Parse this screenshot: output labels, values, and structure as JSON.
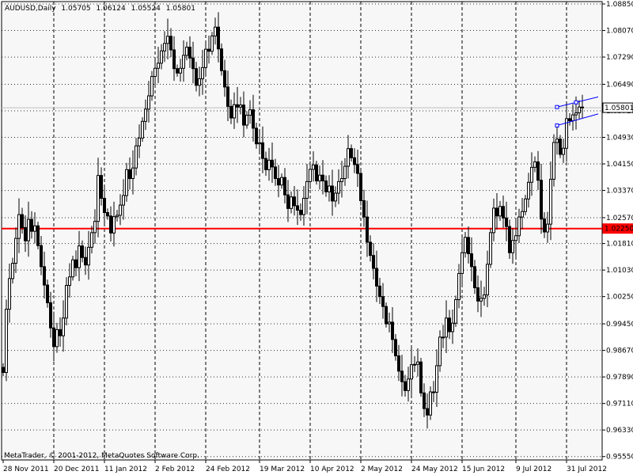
{
  "header": {
    "symbol": "AUDUSD,Daily",
    "open": "1.05705",
    "high": "1.06124",
    "low": "1.05524",
    "close": "1.05801"
  },
  "copyright": "MetaTrader, © 2001-2012, MetaQuotes Software Corp.",
  "colors": {
    "grid": "#000000",
    "plot_bg": "#f7f7f7",
    "candle": "#000000",
    "support_line": "#ff0000",
    "channel": "#0000ff",
    "current_price_line": "#c0c0c0"
  },
  "chart_data": {
    "type": "candlestick",
    "title": "AUDUSD,Daily",
    "ylim": [
      0.9545,
      1.0892
    ],
    "y_ticks": [
      "1.08850",
      "1.08070",
      "1.07290",
      "1.06490",
      "1.05710",
      "1.04930",
      "1.04150",
      "1.03370",
      "1.02570",
      "1.01810",
      "1.01030",
      "1.00250",
      "0.99450",
      "0.98670",
      "0.97890",
      "0.97110",
      "0.96330",
      "0.95550"
    ],
    "x_ticks": [
      "28 Nov 2011",
      "20 Dec 2011",
      "11 Jan 2012",
      "2 Feb 2012",
      "24 Feb 2012",
      "19 Mar 2012",
      "10 Apr 2012",
      "2 May 2012",
      "24 May 2012",
      "15 Jun 2012",
      "9 Jul 2012",
      "31 Jul 2012"
    ],
    "horizontal_lines": [
      {
        "price": 1.0225,
        "label": "1.02250",
        "color": "#ff0000"
      },
      {
        "price": 1.05801,
        "label": "1.05801",
        "color": "#c0c0c0"
      }
    ],
    "channel": {
      "start_bar": 175,
      "end_bar": 188,
      "upper": [
        1.0582,
        1.0612
      ],
      "lower": [
        1.0528,
        1.0562
      ]
    },
    "bar_count": 186,
    "closes": [
      0.9802,
      0.9988,
      1.0078,
      1.0123,
      1.0196,
      1.0266,
      1.0228,
      1.0189,
      1.0252,
      1.0217,
      1.0233,
      1.0175,
      1.0113,
      1.0059,
      1.0007,
      0.9933,
      0.9878,
      0.9928,
      0.991,
      0.9962,
      1.0058,
      1.0083,
      1.0133,
      1.011,
      1.0174,
      1.014,
      1.0118,
      1.017,
      1.0213,
      1.0246,
      1.0381,
      1.0314,
      1.0272,
      1.0262,
      1.0212,
      1.026,
      1.0264,
      1.0294,
      1.0322,
      1.0398,
      1.0372,
      1.0403,
      1.0468,
      1.0491,
      1.054,
      1.0576,
      1.0615,
      1.0672,
      1.0696,
      1.0711,
      1.0747,
      1.0769,
      1.079,
      1.075,
      1.0695,
      1.0682,
      1.0696,
      1.0734,
      1.0758,
      1.0726,
      1.0695,
      1.0646,
      1.0665,
      1.0698,
      1.0752,
      1.0746,
      1.0791,
      1.0817,
      1.0753,
      1.0689,
      1.0641,
      1.0584,
      1.055,
      1.0589,
      1.0582,
      1.0588,
      1.0529,
      1.0558,
      1.0574,
      1.052,
      1.0474,
      1.0477,
      1.0431,
      1.0398,
      1.0426,
      1.0406,
      1.0372,
      1.0353,
      1.0375,
      1.0324,
      1.0284,
      1.0318,
      1.0292,
      1.0279,
      1.0266,
      1.0314,
      1.0363,
      1.0399,
      1.0412,
      1.0365,
      1.0382,
      1.0365,
      1.0333,
      1.035,
      1.0306,
      1.0329,
      1.0363,
      1.0372,
      1.0408,
      1.046,
      1.0433,
      1.0413,
      1.0387,
      1.0307,
      1.0259,
      1.0185,
      1.0146,
      1.0108,
      1.0056,
      1.0025,
      0.9996,
      0.9945,
      0.995,
      0.9899,
      0.9851,
      0.9806,
      0.9775,
      0.9749,
      0.9783,
      0.9825,
      0.9826,
      0.9833,
      0.9742,
      0.9696,
      0.9677,
      0.9745,
      0.9744,
      0.9822,
      0.9906,
      0.9906,
      0.9962,
      0.9922,
      0.9947,
      1.0016,
      1.0093,
      1.0154,
      1.0199,
      1.0151,
      1.0113,
      1.0051,
      1.0012,
      1.002,
      1.003,
      1.012,
      1.0213,
      1.0285,
      1.0262,
      1.029,
      1.0256,
      1.0231,
      1.0154,
      1.019,
      1.0204,
      1.0259,
      1.0275,
      1.0312,
      1.0361,
      1.0405,
      1.0421,
      1.0367,
      1.0253,
      1.0215,
      1.0238,
      1.037,
      1.0478,
      1.0488,
      1.0443,
      1.0461,
      1.0548,
      1.0542,
      1.0559,
      1.0565,
      1.0582,
      1.058
    ]
  }
}
